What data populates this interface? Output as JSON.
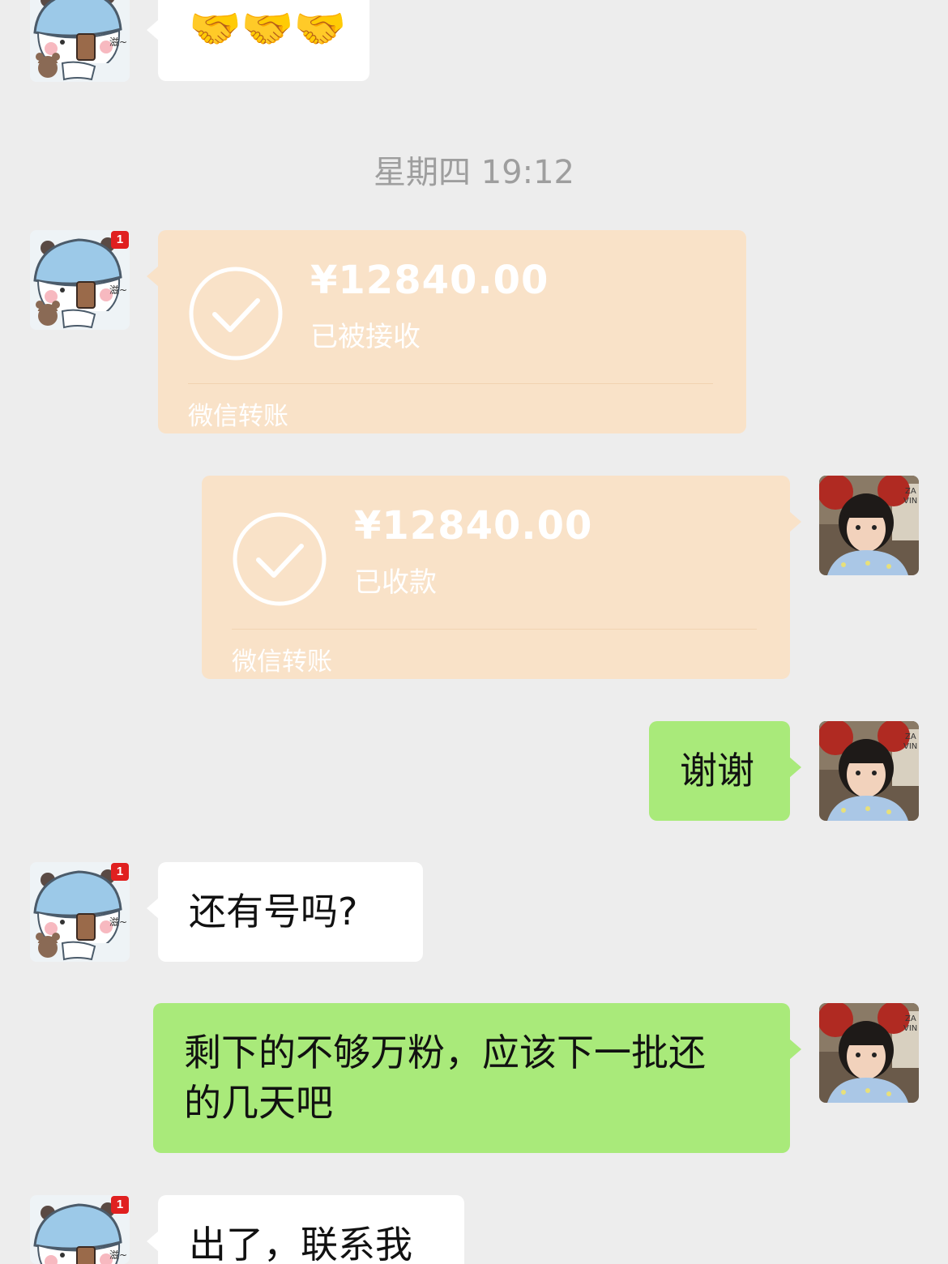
{
  "chat": {
    "timestamp": "星期四 19:12",
    "messages": {
      "m0_emoji": "🤝🤝🤝",
      "transfer1": {
        "amount": "¥12840.00",
        "status": "已被接收",
        "footer": "微信转账"
      },
      "transfer2": {
        "amount": "¥12840.00",
        "status": "已收款",
        "footer": "微信转账"
      },
      "m3_text": "谢谢",
      "m4_text": "还有号吗?",
      "m5_line1": "剩下的不够万粉，应该下一批还",
      "m5_line2": "的几天吧",
      "m6_text": "出了，联系我"
    },
    "contact": {
      "badge": "1",
      "avatar_caption": "滋~"
    }
  },
  "colors": {
    "background": "#ededed",
    "incoming_bubble": "#ffffff",
    "outgoing_bubble": "#a9ea7a",
    "transfer_bubble": "#f9e2c8",
    "timestamp_text": "#9e9e9e"
  },
  "icons": {
    "contact_avatar": "panda-hat-avatar-icon",
    "self_avatar": "girl-photo-avatar",
    "transfer_check": "check-circle-icon"
  }
}
